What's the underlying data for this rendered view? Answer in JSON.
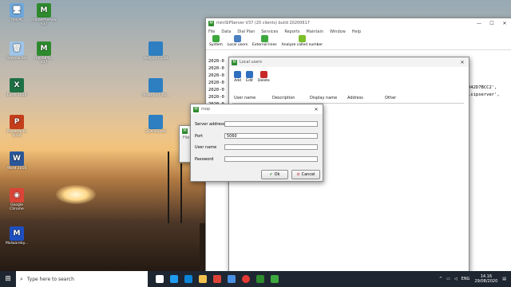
{
  "desktop": {
    "icons": [
      {
        "label": "This PC",
        "color": "#6fa8dc",
        "glyph": "🖥"
      },
      {
        "label": "miniSIPServer V37",
        "color": "#2e8b2e",
        "glyph": "M"
      },
      {
        "label": "Recycle Bin",
        "color": "#9fc5e8",
        "glyph": "🗑"
      },
      {
        "label": "miniSIPS... V37",
        "color": "#2e8b2e",
        "glyph": "M"
      },
      {
        "label": "Excel 2016",
        "color": "#1e7145",
        "glyph": "X"
      },
      {
        "label": "PowerPoint 2016",
        "color": "#c43e1c",
        "glyph": "P"
      },
      {
        "label": "Word 2016",
        "color": "#2b579a",
        "glyph": "W"
      },
      {
        "label": "Google Chrome",
        "color": "#db4437",
        "glyph": "◉"
      },
      {
        "label": "Malwareby...",
        "color": "#1f4fbf",
        "glyph": "M"
      }
    ],
    "mid_icons": [
      {
        "label": "mss_v37_c20",
        "color": "#2d7fc1"
      },
      {
        "label": "mssp_v37_cli...",
        "color": "#2d7fc1"
      },
      {
        "label": "3CXPhone6",
        "color": "#2d7fc1"
      }
    ]
  },
  "main_window": {
    "title": "miniSIPServer V37 (20 clients) build 20200617",
    "menu": [
      "File",
      "Data",
      "Dial Plan",
      "Services",
      "Reports",
      "Maintain",
      "Window",
      "Help"
    ],
    "toolbar": [
      {
        "label": "System",
        "color": "#3ea83e"
      },
      {
        "label": "Local users",
        "color": "#4a7fc1"
      },
      {
        "label": "External lines",
        "color": "#3ea83e"
      },
      {
        "label": "Analyze called number",
        "color": "#7bbf2a"
      }
    ],
    "log_lines": [
      "2020-0",
      "2020-0",
      "2020-0",
      "2020-0",
      "2020-0",
      "2020-0",
      "2020-0"
    ],
    "log_right": [
      "042D7BCC2',",
      "isipserver',"
    ]
  },
  "local_users": {
    "title": "Local users",
    "toolbar": [
      {
        "label": "Add",
        "color": "#2f6fbf"
      },
      {
        "label": "Edit",
        "color": "#2f6fbf"
      },
      {
        "label": "Delete",
        "color": "#c62828"
      }
    ],
    "columns": [
      "User name",
      "Description",
      "Display name",
      "Address",
      "Other"
    ]
  },
  "bg_dialog": {
    "title": "Se",
    "menu": "File"
  },
  "dialog": {
    "title": "mop",
    "fields": [
      {
        "label": "Server address",
        "value": ""
      },
      {
        "label": "Port",
        "value": "5060"
      },
      {
        "label": "User name",
        "value": ""
      },
      {
        "label": "Password",
        "value": ""
      }
    ],
    "ok_label": "Ok",
    "cancel_label": "Cancel"
  },
  "taskbar": {
    "search_placeholder": "Type here to search",
    "apps": [
      {
        "name": "task-view-icon",
        "color": "#ffffff"
      },
      {
        "name": "edge-icon",
        "color": "#1f9cf0"
      },
      {
        "name": "store-icon",
        "color": "#0a84d6"
      },
      {
        "name": "explorer-icon",
        "color": "#f2c14e"
      },
      {
        "name": "chrome-icon",
        "color": "#db4437"
      },
      {
        "name": "media-icon",
        "color": "#4a90e2"
      },
      {
        "name": "record-icon",
        "color": "#e53935"
      },
      {
        "name": "minisip-icon",
        "color": "#2e8b2e"
      },
      {
        "name": "minisip-client-icon",
        "color": "#3ea83e"
      }
    ],
    "language": "ENG",
    "time": "14.16",
    "date": "29/08/2020"
  }
}
